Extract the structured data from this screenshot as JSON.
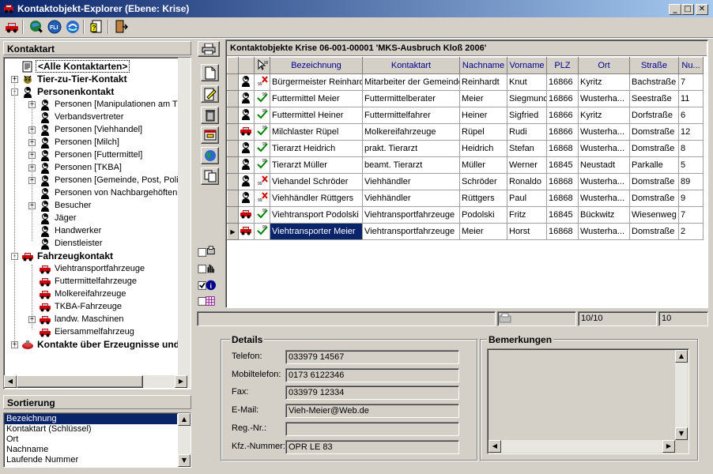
{
  "window": {
    "title": "Kontaktobjekt-Explorer (Ebene: Krise)",
    "min": "_",
    "max": "□",
    "close": "✕"
  },
  "left": {
    "header": "Kontaktart",
    "tree": [
      {
        "label": "<Alle Kontaktarten>",
        "level": 0,
        "bold": true,
        "icon": "document-icon",
        "exp": "",
        "selected": true
      },
      {
        "label": "Tier-zu-Tier-Kontakt",
        "level": 0,
        "bold": true,
        "icon": "animal-icon",
        "exp": "+"
      },
      {
        "label": "Personenkontakt",
        "level": 0,
        "bold": true,
        "icon": "person-icon",
        "exp": "-"
      },
      {
        "label": "Personen [Manipulationen am Tier]",
        "level": 1,
        "icon": "person-icon",
        "exp": "+"
      },
      {
        "label": "Verbandsvertreter",
        "level": 1,
        "icon": "person-icon",
        "exp": ""
      },
      {
        "label": "Personen [Viehhandel]",
        "level": 1,
        "icon": "person-icon",
        "exp": "+"
      },
      {
        "label": "Personen [Milch]",
        "level": 1,
        "icon": "person-icon",
        "exp": "+"
      },
      {
        "label": "Personen [Futtermittel]",
        "level": 1,
        "icon": "person-icon",
        "exp": "+"
      },
      {
        "label": "Personen [TKBA]",
        "level": 1,
        "icon": "person-icon",
        "exp": "+"
      },
      {
        "label": "Personen [Gemeinde, Post, Polizei]",
        "level": 1,
        "icon": "person-icon",
        "exp": "+"
      },
      {
        "label": "Personen von Nachbargehöften",
        "level": 1,
        "icon": "person-icon",
        "exp": ""
      },
      {
        "label": "Besucher",
        "level": 1,
        "icon": "person-icon",
        "exp": "+"
      },
      {
        "label": "Jäger",
        "level": 1,
        "icon": "person-icon",
        "exp": ""
      },
      {
        "label": "Handwerker",
        "level": 1,
        "icon": "person-icon",
        "exp": ""
      },
      {
        "label": "Dienstleister",
        "level": 1,
        "icon": "person-icon",
        "exp": ""
      },
      {
        "label": "Fahrzeugkontakt",
        "level": 0,
        "bold": true,
        "icon": "car-icon",
        "exp": "-"
      },
      {
        "label": "Viehtransportfahrzeuge",
        "level": 1,
        "icon": "car-icon",
        "exp": ""
      },
      {
        "label": "Futtermittelfahrzeuge",
        "level": 1,
        "icon": "car-icon",
        "exp": ""
      },
      {
        "label": "Molkereifahrzeuge",
        "level": 1,
        "icon": "car-icon",
        "exp": ""
      },
      {
        "label": "TKBA-Fahrzeuge",
        "level": 1,
        "icon": "car-icon",
        "exp": ""
      },
      {
        "label": "landw. Maschinen",
        "level": 1,
        "icon": "car-icon",
        "exp": "+"
      },
      {
        "label": "Eiersammelfahrzeug",
        "level": 1,
        "icon": "car-icon",
        "exp": ""
      },
      {
        "label": "Kontakte über Erzeugnisse und S",
        "level": 0,
        "bold": true,
        "icon": "products-icon",
        "exp": "+"
      }
    ],
    "sort_header": "Sortierung",
    "sort_items": [
      "Bezeichnung",
      "Kontaktart (Schlüssel)",
      "Ort",
      "Nachname",
      "Laufende Nummer"
    ]
  },
  "grid": {
    "title": "Kontaktobjekte Krise 06-001-00001 'MKS-Ausbruch Kloß 2006'",
    "columns": [
      "Bezeichnung",
      "Kontaktart",
      "Nachname",
      "Vorname",
      "PLZ",
      "Ort",
      "Straße",
      "Nu..."
    ],
    "rows": [
      {
        "type": "person",
        "status": "x",
        "cells": [
          "Bürgermeister Reinhardt",
          "Mitarbeiter der Gemeinde",
          "Reinhardt",
          "Knut",
          "16866",
          "Kyritz",
          "Bachstraße",
          "7"
        ]
      },
      {
        "type": "person",
        "status": "ok",
        "cells": [
          "Futtermittel Meier",
          "Futtermittelberater",
          "Meier",
          "Siegmund",
          "16866",
          "Wusterha...",
          "Seestraße",
          "11"
        ]
      },
      {
        "type": "person",
        "status": "ok",
        "cells": [
          "Futtermittel Heiner",
          "Futtermittelfahrer",
          "Heiner",
          "Sigfried",
          "16866",
          "Kyritz",
          "Dorfstraße",
          "6"
        ]
      },
      {
        "type": "car",
        "status": "ok",
        "cells": [
          "Milchlaster Rüpel",
          "Molkereifahrzeuge",
          "Rüpel",
          "Rudi",
          "16866",
          "Wusterha...",
          "Domstraße",
          "12"
        ]
      },
      {
        "type": "person",
        "status": "ok",
        "cells": [
          "Tierarzt Heidrich",
          "prakt. Tierarzt",
          "Heidrich",
          "Stefan",
          "16868",
          "Wusterha...",
          "Domstraße",
          "8"
        ]
      },
      {
        "type": "person",
        "status": "ok",
        "cells": [
          "Tierarzt Müller",
          "beamt. Tierarzt",
          "Müller",
          "Werner",
          "16845",
          "Neustadt",
          "Parkalle",
          "5"
        ]
      },
      {
        "type": "person",
        "status": "x",
        "cells": [
          "Viehandel Schröder",
          "Viehhändler",
          "Schröder",
          "Ronaldo",
          "16868",
          "Wusterha...",
          "Domstraße",
          "89"
        ]
      },
      {
        "type": "person",
        "status": "x",
        "cells": [
          "Viehhändler Rüttgers",
          "Viehhändler",
          "Rüttgers",
          "Paul",
          "16868",
          "Wusterha...",
          "Domstraße",
          "9"
        ]
      },
      {
        "type": "car",
        "status": "ok",
        "cells": [
          "Viehtransport Podolski",
          "Viehtransportfahrzeuge",
          "Podolski",
          "Fritz",
          "16845",
          "Bückwitz",
          "Wiesenweg",
          "7"
        ]
      },
      {
        "type": "car",
        "status": "ok",
        "cells": [
          "Viehtransporter Meier",
          "Viehtransportfahrzeuge",
          "Meier",
          "Horst",
          "16868",
          "Wusterha...",
          "Domstraße",
          "2"
        ],
        "current": true
      }
    ],
    "status": {
      "position": "10/10",
      "count": "10"
    }
  },
  "details": {
    "title": "Details",
    "fields": [
      {
        "label": "Telefon:",
        "value": "033979 14567"
      },
      {
        "label": "Mobiltelefon:",
        "value": "0173 6122346"
      },
      {
        "label": "Fax:",
        "value": "033979 12334"
      },
      {
        "label": "E-Mail:",
        "value": "Vieh-Meier@Web.de"
      },
      {
        "label": "Reg.-Nr.:",
        "value": ""
      },
      {
        "label": "Kfz.-Nummer:",
        "value": "OPR LE 83"
      }
    ]
  },
  "remarks": {
    "title": "Bemerkungen",
    "text": ""
  }
}
